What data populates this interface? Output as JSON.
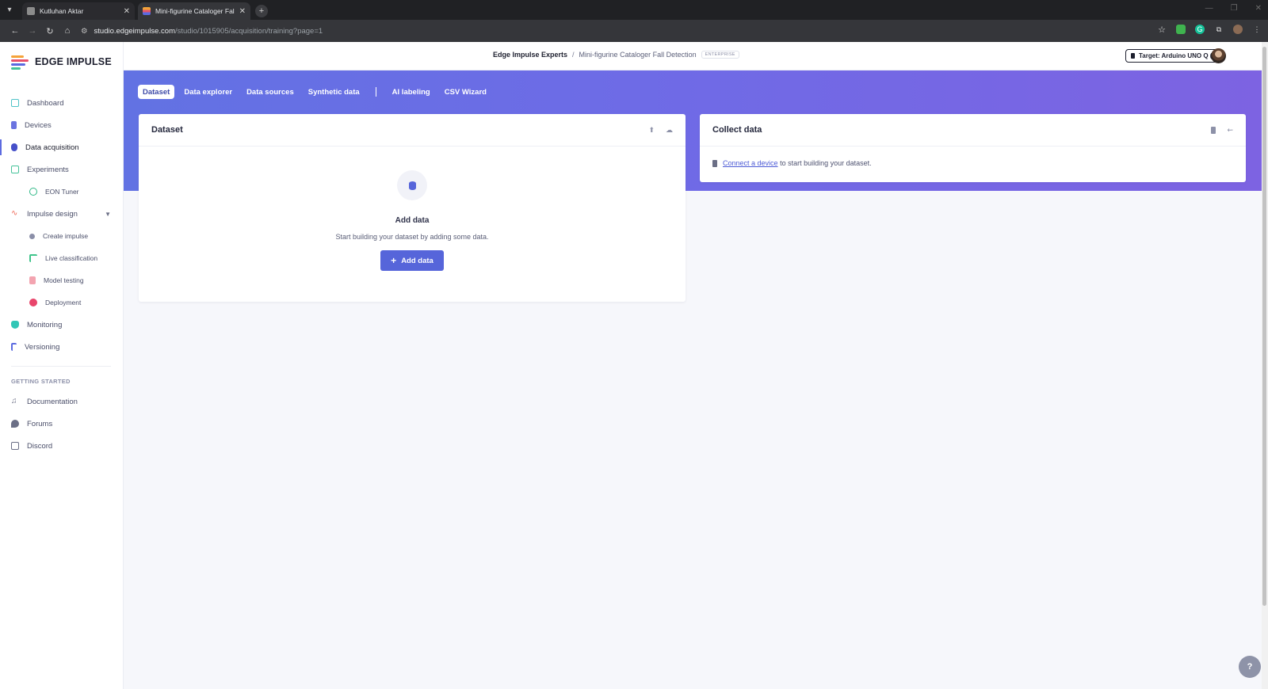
{
  "browser": {
    "tabs": [
      {
        "title": "Kutluhan Aktar",
        "favicon": "profile-icon"
      },
      {
        "title": "Mini-figurine Cataloger Fall Detection",
        "favicon": "edge-impulse-icon"
      }
    ],
    "url_host": "studio.edgeimpulse.com",
    "url_path": "/studio/1015905/acquisition/training?page=1"
  },
  "brand": {
    "name": "EDGE IMPULSE",
    "accent": "#5665da"
  },
  "sidebar": {
    "items": [
      {
        "label": "Dashboard",
        "icon": "monitor-icon",
        "color": "#4fc3c8"
      },
      {
        "label": "Devices",
        "icon": "device-icon",
        "color": "#6b74e0"
      },
      {
        "label": "Data acquisition",
        "icon": "database-icon",
        "color": "#4650c9"
      },
      {
        "label": "Experiments",
        "icon": "grid-icon",
        "color": "#46c39a"
      },
      {
        "label": "EON Tuner",
        "icon": "compass-icon",
        "color": "#2fb886"
      },
      {
        "label": "Impulse design",
        "icon": "pulse-icon",
        "color": "#ef6a5a"
      },
      {
        "label": "Create impulse",
        "icon": "dot-icon",
        "color": "#8b8fa8"
      },
      {
        "label": "Live classification",
        "icon": "branch-icon",
        "color": "#3fc48b"
      },
      {
        "label": "Model testing",
        "icon": "clipboard-icon",
        "color": "#ee7b8b"
      },
      {
        "label": "Deployment",
        "icon": "box-icon",
        "color": "#e8456b"
      },
      {
        "label": "Monitoring",
        "icon": "binoculars-icon",
        "color": "#31c6b6"
      },
      {
        "label": "Versioning",
        "icon": "git-icon",
        "color": "#5b6be0"
      }
    ],
    "getting_started_heading": "GETTING STARTED",
    "help_items": [
      {
        "label": "Documentation",
        "icon": "book-icon"
      },
      {
        "label": "Forums",
        "icon": "chat-icon"
      },
      {
        "label": "Discord",
        "icon": "discord-icon"
      }
    ]
  },
  "header": {
    "org": "Edge Impulse Experts",
    "separator": "/",
    "project": "Mini-figurine Cataloger Fall Detection",
    "badge": "ENTERPRISE",
    "target": "Target: Arduino UNO Q (..."
  },
  "subtabs": [
    "Dataset",
    "Data explorer",
    "Data sources",
    "Synthetic data",
    "AI labeling",
    "CSV Wizard"
  ],
  "dataset_card": {
    "title": "Dataset",
    "empty_title": "Add data",
    "empty_sub": "Start building your dataset by adding some data.",
    "button": "Add data"
  },
  "collect_card": {
    "title": "Collect data",
    "link": "Connect a device",
    "text": "to start building your dataset."
  },
  "help": "?"
}
